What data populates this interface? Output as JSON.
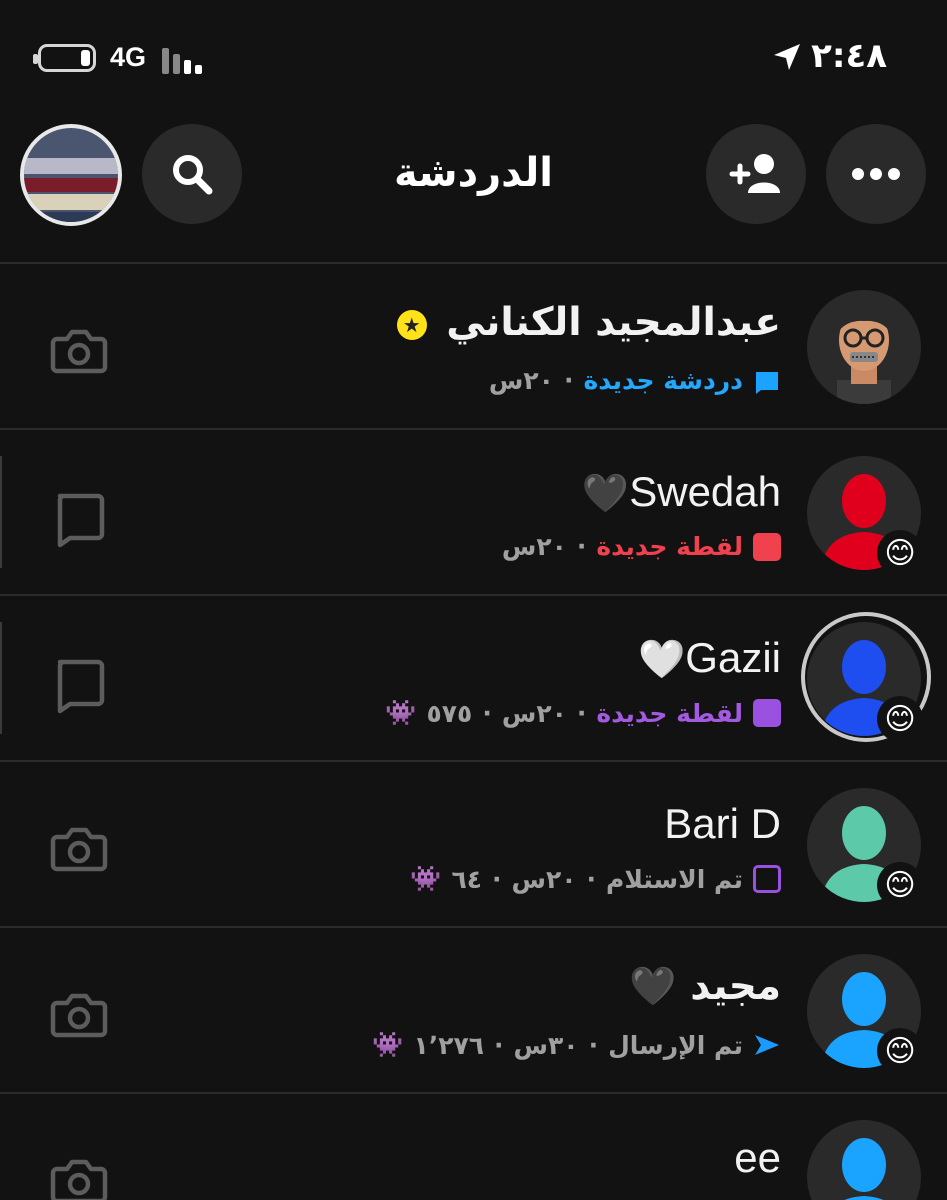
{
  "status_bar": {
    "network": "4G",
    "time": "٢:٤٨"
  },
  "header": {
    "title": "الدردشة"
  },
  "colors": {
    "new_chat": "#0ea5ff",
    "new_snap_red": "#f0414f",
    "new_snap_purple": "#9b51e0",
    "delivered": "#9b51e0",
    "sent": "#1a9bff"
  },
  "chats": [
    {
      "name": "عبدالمجيد الكناني",
      "badge": "star-badge-icon",
      "status": "دردشة جديدة",
      "status_color": "#22a8ff",
      "time": "٢٠س",
      "streak": "",
      "action_icon": "camera-icon"
    },
    {
      "name": "Swedah",
      "name_emoji": "🖤",
      "status": "لقطة جديدة",
      "status_color": "#f0414f",
      "time": "٢٠س",
      "streak": "",
      "action_icon": "chat-bubble-icon"
    },
    {
      "name": "Gazii",
      "name_emoji": "🤍",
      "status": "لقطة جديدة",
      "status_color": "#a25ade",
      "time": "٢٠س",
      "streak": "٥٧٥",
      "streak_emoji": "👾",
      "action_icon": "chat-bubble-icon"
    },
    {
      "name": "Bari D",
      "status": "تم الاستلام",
      "status_color": "#a0a0a0",
      "time": "٢٠س",
      "streak": "٦٤",
      "streak_emoji": "👾",
      "action_icon": "camera-icon"
    },
    {
      "name": "مجيد",
      "name_emoji": "🖤",
      "status": "تم الإرسال",
      "status_color": "#a0a0a0",
      "time": "٣٠س",
      "streak": "١٬٢٧٦",
      "streak_emoji": "👾",
      "action_icon": "camera-icon"
    },
    {
      "name": "ee",
      "action_icon": "camera-icon"
    }
  ],
  "avatar_badge_emoji": "😊"
}
